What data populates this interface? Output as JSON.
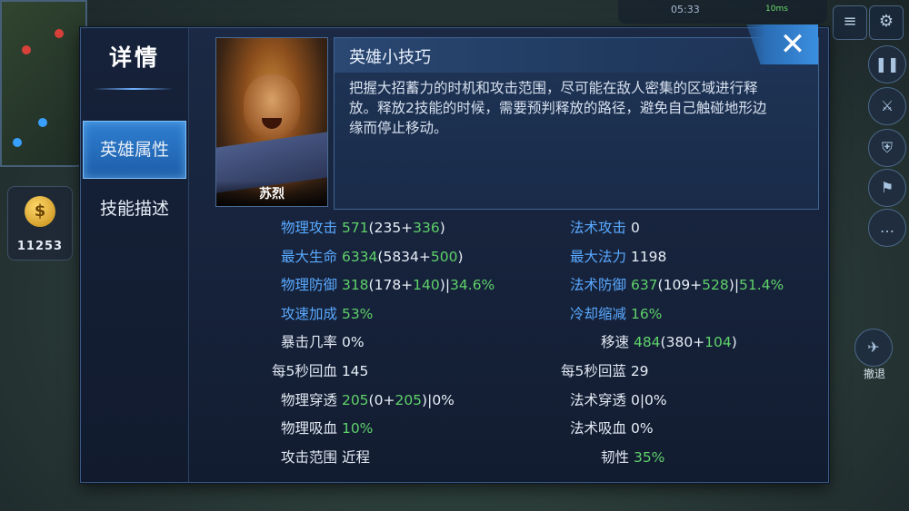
{
  "background": {
    "gold": "11253",
    "time": "05:33",
    "network": "10ms",
    "side_button_label": "撤退"
  },
  "dialog": {
    "title": "详情",
    "tabs": [
      {
        "label": "英雄属性",
        "active": true
      },
      {
        "label": "技能描述",
        "active": false
      }
    ],
    "hero_name": "苏烈",
    "tips_title": "英雄小技巧",
    "tips_text": "把握大招蓄力的时机和攻击范围，尽可能在敌人密集的区域进行释放。释放2技能的时候，需要预判释放的路径，避免自己触碰地形边缘而停止移动。"
  },
  "stats": {
    "left": [
      {
        "label": "物理攻击",
        "label_color": "blue",
        "parts": [
          {
            "t": "571",
            "c": "green"
          },
          {
            "t": "(235+",
            "c": "white"
          },
          {
            "t": "336",
            "c": "green"
          },
          {
            "t": ")",
            "c": "white"
          }
        ]
      },
      {
        "label": "最大生命",
        "label_color": "blue",
        "parts": [
          {
            "t": "6334",
            "c": "green"
          },
          {
            "t": "(5834+",
            "c": "white"
          },
          {
            "t": "500",
            "c": "green"
          },
          {
            "t": ")",
            "c": "white"
          }
        ]
      },
      {
        "label": "物理防御",
        "label_color": "blue",
        "parts": [
          {
            "t": "318",
            "c": "green"
          },
          {
            "t": "(178+",
            "c": "white"
          },
          {
            "t": "140",
            "c": "green"
          },
          {
            "t": ")|",
            "c": "white"
          },
          {
            "t": "34.6%",
            "c": "green"
          }
        ]
      },
      {
        "label": "攻速加成",
        "label_color": "blue",
        "parts": [
          {
            "t": "53%",
            "c": "green"
          }
        ]
      },
      {
        "label": "暴击几率",
        "label_color": "white",
        "parts": [
          {
            "t": "0%",
            "c": "white"
          }
        ]
      },
      {
        "label": "每5秒回血",
        "label_color": "white",
        "parts": [
          {
            "t": "145",
            "c": "white"
          }
        ]
      },
      {
        "label": "物理穿透",
        "label_color": "white",
        "parts": [
          {
            "t": "205",
            "c": "green"
          },
          {
            "t": "(0+",
            "c": "white"
          },
          {
            "t": "205",
            "c": "green"
          },
          {
            "t": ")|0%",
            "c": "white"
          }
        ]
      },
      {
        "label": "物理吸血",
        "label_color": "white",
        "parts": [
          {
            "t": "10%",
            "c": "green"
          }
        ]
      },
      {
        "label": "攻击范围",
        "label_color": "white",
        "parts": [
          {
            "t": "近程",
            "c": "white"
          }
        ]
      }
    ],
    "right": [
      {
        "label": "法术攻击",
        "label_color": "blue",
        "parts": [
          {
            "t": "0",
            "c": "white"
          }
        ]
      },
      {
        "label": "最大法力",
        "label_color": "blue",
        "parts": [
          {
            "t": "1198",
            "c": "white"
          }
        ]
      },
      {
        "label": "法术防御",
        "label_color": "blue",
        "parts": [
          {
            "t": "637",
            "c": "green"
          },
          {
            "t": "(109+",
            "c": "white"
          },
          {
            "t": "528",
            "c": "green"
          },
          {
            "t": ")|",
            "c": "white"
          },
          {
            "t": "51.4%",
            "c": "green"
          }
        ]
      },
      {
        "label": "冷却缩减",
        "label_color": "blue",
        "parts": [
          {
            "t": "16%",
            "c": "green"
          }
        ]
      },
      {
        "label": "移速",
        "label_color": "white",
        "parts": [
          {
            "t": "484",
            "c": "green"
          },
          {
            "t": "(380+",
            "c": "white"
          },
          {
            "t": "104",
            "c": "green"
          },
          {
            "t": ")",
            "c": "white"
          }
        ]
      },
      {
        "label": "每5秒回蓝",
        "label_color": "white",
        "parts": [
          {
            "t": "29",
            "c": "white"
          }
        ]
      },
      {
        "label": "法术穿透",
        "label_color": "white",
        "parts": [
          {
            "t": "0|0%",
            "c": "white"
          }
        ]
      },
      {
        "label": "法术吸血",
        "label_color": "white",
        "parts": [
          {
            "t": "0%",
            "c": "white"
          }
        ]
      },
      {
        "label": "韧性",
        "label_color": "white",
        "parts": [
          {
            "t": "35%",
            "c": "green"
          }
        ]
      }
    ]
  }
}
